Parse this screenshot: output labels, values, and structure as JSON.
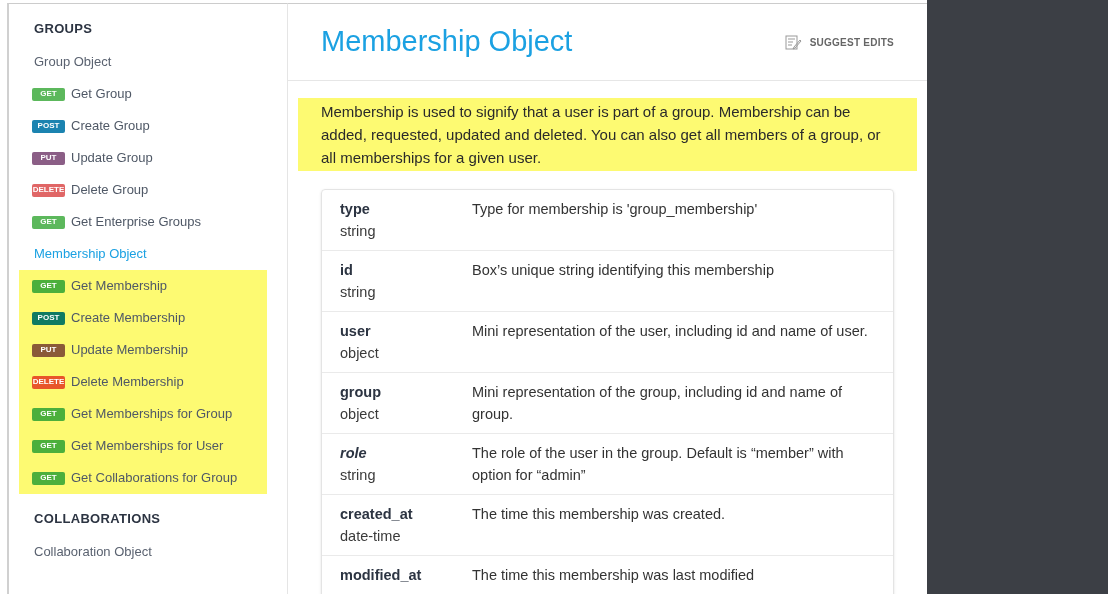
{
  "sidebar": {
    "sections": [
      {
        "heading": "GROUPS",
        "items": [
          {
            "kind": "link",
            "label": "Group Object",
            "selected": false,
            "highlighted": false
          },
          {
            "kind": "endpoint",
            "method": "GET",
            "color": "#5cb85c",
            "label": "Get Group",
            "selected": false,
            "highlighted": false
          },
          {
            "kind": "endpoint",
            "method": "POST",
            "color": "#1b83b0",
            "label": "Create Group",
            "selected": false,
            "highlighted": false
          },
          {
            "kind": "endpoint",
            "method": "PUT",
            "color": "#8b5e86",
            "label": "Update Group",
            "selected": false,
            "highlighted": false
          },
          {
            "kind": "endpoint",
            "method": "DELETE",
            "color": "#e06666",
            "label": "Delete Group",
            "selected": false,
            "highlighted": false
          },
          {
            "kind": "endpoint",
            "method": "GET",
            "color": "#5cb85c",
            "label": "Get Enterprise Groups",
            "selected": false,
            "highlighted": false
          },
          {
            "kind": "link",
            "label": "Membership Object",
            "selected": true,
            "highlighted": false
          },
          {
            "kind": "endpoint",
            "method": "GET",
            "color": "#4caf3c",
            "label": "Get Membership",
            "selected": false,
            "highlighted": true
          },
          {
            "kind": "endpoint",
            "method": "POST",
            "color": "#107a62",
            "label": "Create Membership",
            "selected": false,
            "highlighted": true
          },
          {
            "kind": "endpoint",
            "method": "PUT",
            "color": "#8a5a38",
            "label": "Update Membership",
            "selected": false,
            "highlighted": true
          },
          {
            "kind": "endpoint",
            "method": "DELETE",
            "color": "#e8552a",
            "label": "Delete Membership",
            "selected": false,
            "highlighted": true
          },
          {
            "kind": "endpoint",
            "method": "GET",
            "color": "#4caf3c",
            "label": "Get Memberships for Group",
            "selected": false,
            "highlighted": true
          },
          {
            "kind": "endpoint",
            "method": "GET",
            "color": "#4caf3c",
            "label": "Get Memberships for User",
            "selected": false,
            "highlighted": true
          },
          {
            "kind": "endpoint",
            "method": "GET",
            "color": "#4caf3c",
            "label": "Get Collaborations for Group",
            "selected": false,
            "highlighted": true
          }
        ]
      },
      {
        "heading": "COLLABORATIONS",
        "items": [
          {
            "kind": "link",
            "label": "Collaboration Object",
            "selected": false,
            "highlighted": false
          }
        ]
      }
    ]
  },
  "page": {
    "title": "Membership Object",
    "suggest_edits": "SUGGEST EDITS",
    "intro": "Membership is used to signify that a user is part of a group. Membership can be added, requested, updated and deleted. You can also get all members of a group, or all memberships for a given user.",
    "intro_highlighted": true,
    "fields": [
      {
        "name": "type",
        "italic": false,
        "type": "string",
        "description": "Type for membership is 'group_membership'"
      },
      {
        "name": "id",
        "italic": false,
        "type": "string",
        "description": "Box’s unique string identifying this membership"
      },
      {
        "name": "user",
        "italic": false,
        "type": "object",
        "description": "Mini representation of the user, including id and name of user."
      },
      {
        "name": "group",
        "italic": false,
        "type": "object",
        "description": "Mini representation of the group, including id and name of group."
      },
      {
        "name": "role",
        "italic": true,
        "type": "string",
        "description": "The role of the user in the group. Default is “member” with option for “admin”"
      },
      {
        "name": "created_at",
        "italic": false,
        "type": "date-time",
        "description": "The time this membership was created."
      },
      {
        "name": "modified_at",
        "italic": false,
        "description": "The time this membership was last modified"
      }
    ]
  }
}
